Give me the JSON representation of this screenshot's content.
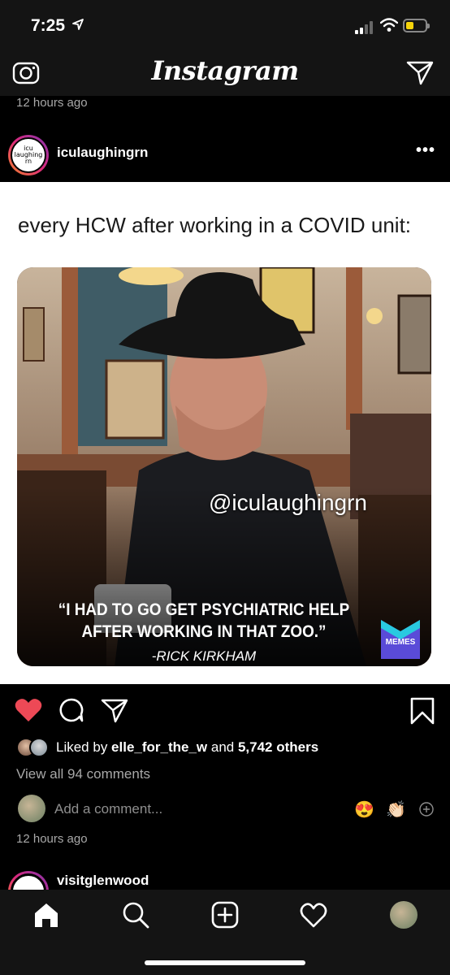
{
  "status_bar": {
    "time": "7:25",
    "location_icon": "location-arrow-icon",
    "battery_color": "#f6d40b"
  },
  "header": {
    "title": "Instagram",
    "left_icon": "camera-icon",
    "right_icon": "direct-message-icon"
  },
  "previous_post": {
    "timestamp": "12 hours ago"
  },
  "post": {
    "username": "iculaughingrn",
    "avatar_text": "icu laughing rn",
    "more_icon": "more-options-icon",
    "media": {
      "caption_text": "every HCW after working in a COVID unit:",
      "watermark": "@iculaughingrn",
      "quote_line_1": "“I HAD TO GO GET PSYCHIATRIC HELP",
      "quote_line_2": "AFTER WORKING IN THAT ZOO.”",
      "credit": "-RICK KIRKHAM",
      "logo_text": "MEMES",
      "logo_color": "#5a4bd8"
    },
    "actions": {
      "like_icon": "heart-filled-icon",
      "comment_icon": "comment-icon",
      "share_icon": "share-icon",
      "save_icon": "bookmark-icon",
      "like_color": "#ed4956"
    },
    "likes": {
      "prefix": "Liked by ",
      "user": "elle_for_the_w",
      "conjunction": " and ",
      "others": "5,742 others"
    },
    "view_comments": "View all 94 comments",
    "add_comment_placeholder": "Add a comment...",
    "quick_emojis": [
      "😍",
      "👏🏻"
    ],
    "timestamp": "12 hours ago"
  },
  "next_post": {
    "username": "visitglenwood"
  },
  "tab_bar": {
    "items": [
      "home-icon",
      "search-icon",
      "new-post-icon",
      "activity-icon",
      "profile-avatar"
    ]
  }
}
